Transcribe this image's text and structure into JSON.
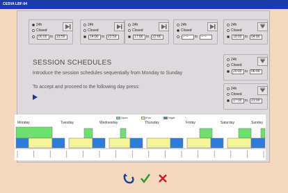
{
  "window": {
    "title": "CESVA LBF-04"
  },
  "options": {
    "on": "24h",
    "closed": "Closed"
  },
  "days": [
    {
      "state": "on",
      "from": "00:00",
      "to": "23:59"
    },
    {
      "state": "custom",
      "from": "14:00",
      "to": "23:59"
    },
    {
      "state": "custom",
      "from": "17:00",
      "to": "22:00"
    },
    {
      "state": "closed",
      "from": "--:--",
      "to": "--:--"
    },
    {
      "state": "custom",
      "from": "19:00",
      "to": "04:00"
    },
    {
      "state": "custom",
      "from": "20:00",
      "to": "06:00"
    },
    {
      "state": "custom",
      "from": "17:00",
      "to": "21:00"
    }
  ],
  "instructions": {
    "heading": "SESSION SCHEDULES",
    "line1": "Introduce the session schedules sequentially from Monday to Sunday",
    "line2": "To accept and proceed to the following day press:"
  },
  "chart": {
    "legend": [
      {
        "label": "Open",
        "color": "#6ee06e"
      },
      {
        "label": "Eve",
        "color": "#f4f49a"
      },
      {
        "label": "Night",
        "color": "#2f7cd8"
      }
    ],
    "days": [
      "Monday",
      "Tuesday",
      "Wednesday",
      "Thursday",
      "Friday",
      "Saturday",
      "Sunday"
    ]
  },
  "buttons": {
    "back_icon": "undo-arrow-icon",
    "accept_icon": "check-icon",
    "cancel_icon": "cross-icon"
  }
}
